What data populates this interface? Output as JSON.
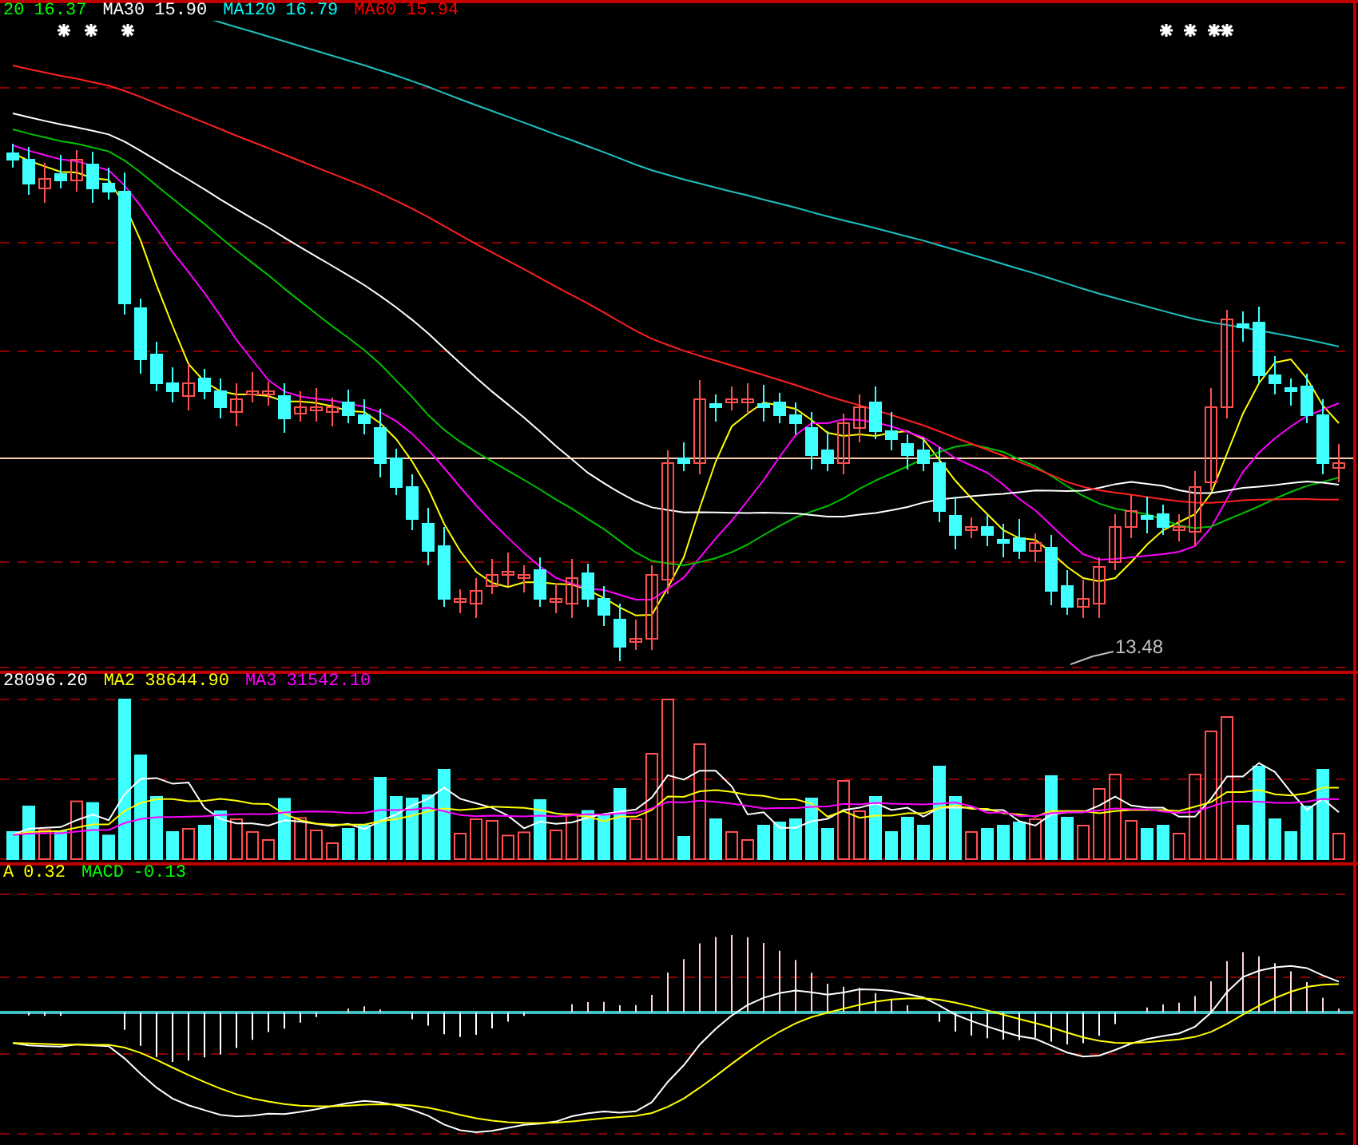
{
  "price_panel": {
    "legend": [
      {
        "label": "20",
        "value": "16.37",
        "color": "#00ff00"
      },
      {
        "label": "MA30",
        "value": "15.90",
        "color": "#ffffff"
      },
      {
        "label": "MA120",
        "value": "16.79",
        "color": "#00ffff"
      },
      {
        "label": "MA60",
        "value": "15.94",
        "color": "#ff0000"
      }
    ],
    "low_label": "13.48"
  },
  "volume_panel": {
    "legend": [
      {
        "value": "28096.20",
        "color": "#ffffff"
      },
      {
        "label": "MA2",
        "value": "38644.90",
        "color": "#ffff00"
      },
      {
        "label": "MA3",
        "value": "31542.10",
        "color": "#ff00ff"
      }
    ]
  },
  "macd_panel": {
    "legend": [
      {
        "label": "A",
        "value": "0.32",
        "color": "#ffff00"
      },
      {
        "label": "MACD",
        "value": "-0.13",
        "color": "#00ff00"
      }
    ]
  }
}
